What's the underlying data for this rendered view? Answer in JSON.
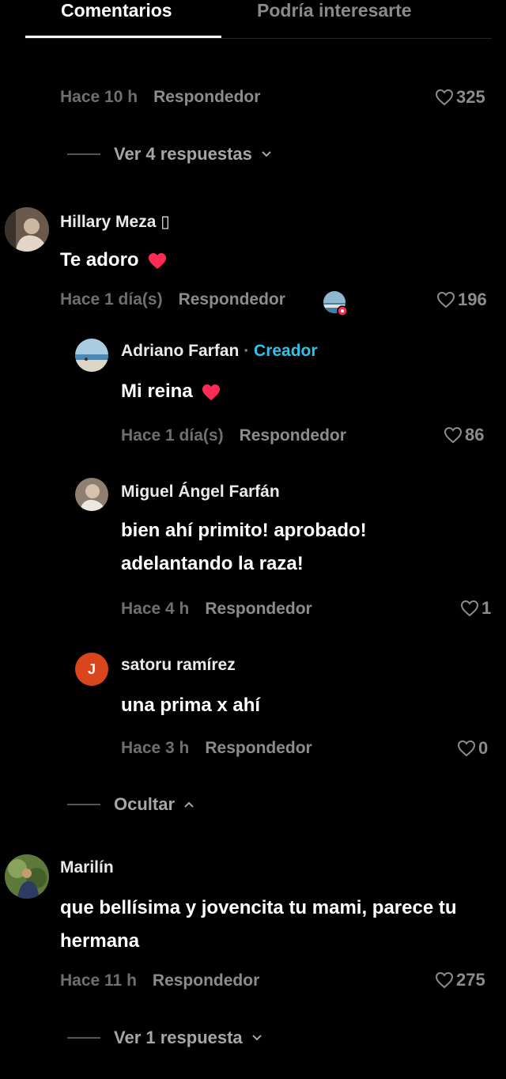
{
  "tabs": [
    {
      "label": "Comentarios",
      "active": true
    },
    {
      "label": "Podría interesarte",
      "active": false
    }
  ],
  "colors": {
    "background": "#000000",
    "creator": "#2fc3e8",
    "heart": "#fe2c55",
    "muted": "#8c8c8c"
  },
  "top_partial": {
    "time": "Hace 10 h",
    "reply": "Respondedor",
    "likes": "325"
  },
  "view_replies_1": {
    "label": "Ver 4 respuestas",
    "icon": "chevron-down-icon"
  },
  "comments": [
    {
      "author": "Hillary Meza ▯",
      "text": "Te adoro",
      "time": "Hace 1 día(s)",
      "reply": "Respondedor",
      "likes": "196",
      "replies": [
        {
          "author": "Adriano Farfan",
          "sep": " · ",
          "badge": "Creador",
          "text": "Mi reina",
          "time": "Hace 1 día(s)",
          "reply": "Respondedor",
          "likes": "86"
        },
        {
          "author": "Miguel Ángel Farfán",
          "text_line1": "bien ahí primito! aprobado!",
          "text_line2": "adelantando la raza!",
          "time": "Hace 4 h",
          "reply": "Respondedor",
          "likes": "1"
        },
        {
          "author": "satoru ramírez",
          "avatar_letter": "J",
          "text": "una prima x ahí",
          "time": "Hace 3 h",
          "reply": "Respondedor",
          "likes": "0"
        }
      ],
      "hide_label": "Ocultar"
    },
    {
      "author": "Marilín",
      "text_line1": "que bellísima y jovencita tu mami, parece tu",
      "text_line2": "hermana",
      "time": "Hace 11 h",
      "reply": "Respondedor",
      "likes": "275"
    }
  ],
  "view_replies_2": {
    "label": "Ver 1 respuesta",
    "icon": "chevron-down-icon"
  }
}
